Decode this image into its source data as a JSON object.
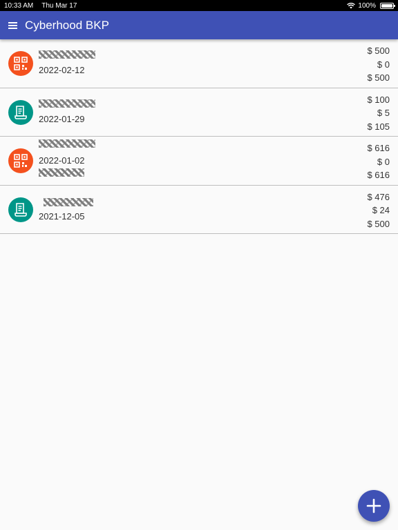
{
  "status_bar": {
    "time": "10:33 AM",
    "date": "Thu Mar 17",
    "battery": "100%",
    "icons": [
      "wifi-icon",
      "battery-icon"
    ]
  },
  "app_bar": {
    "title": "Cyberhood BKP",
    "menu_icon": "menu-icon",
    "color": "#3f51b5"
  },
  "transactions": [
    {
      "icon": "qr-code-icon",
      "icon_color": "#f4511e",
      "date": "2022-02-12",
      "amount": "$ 500",
      "fee": "$ 0",
      "total": "$ 500"
    },
    {
      "icon": "receipt-icon",
      "icon_color": "#009688",
      "date": "2022-01-29",
      "amount": "$ 100",
      "fee": "$ 5",
      "total": "$ 105"
    },
    {
      "icon": "qr-code-icon",
      "icon_color": "#f4511e",
      "date": "2022-01-02",
      "amount": "$ 616",
      "fee": "$ 0",
      "total": "$ 616"
    },
    {
      "icon": "receipt-icon",
      "icon_color": "#009688",
      "date": "2021-12-05",
      "amount": "$ 476",
      "fee": "$ 24",
      "total": "$ 500"
    }
  ],
  "fab": {
    "icon": "add-icon"
  }
}
